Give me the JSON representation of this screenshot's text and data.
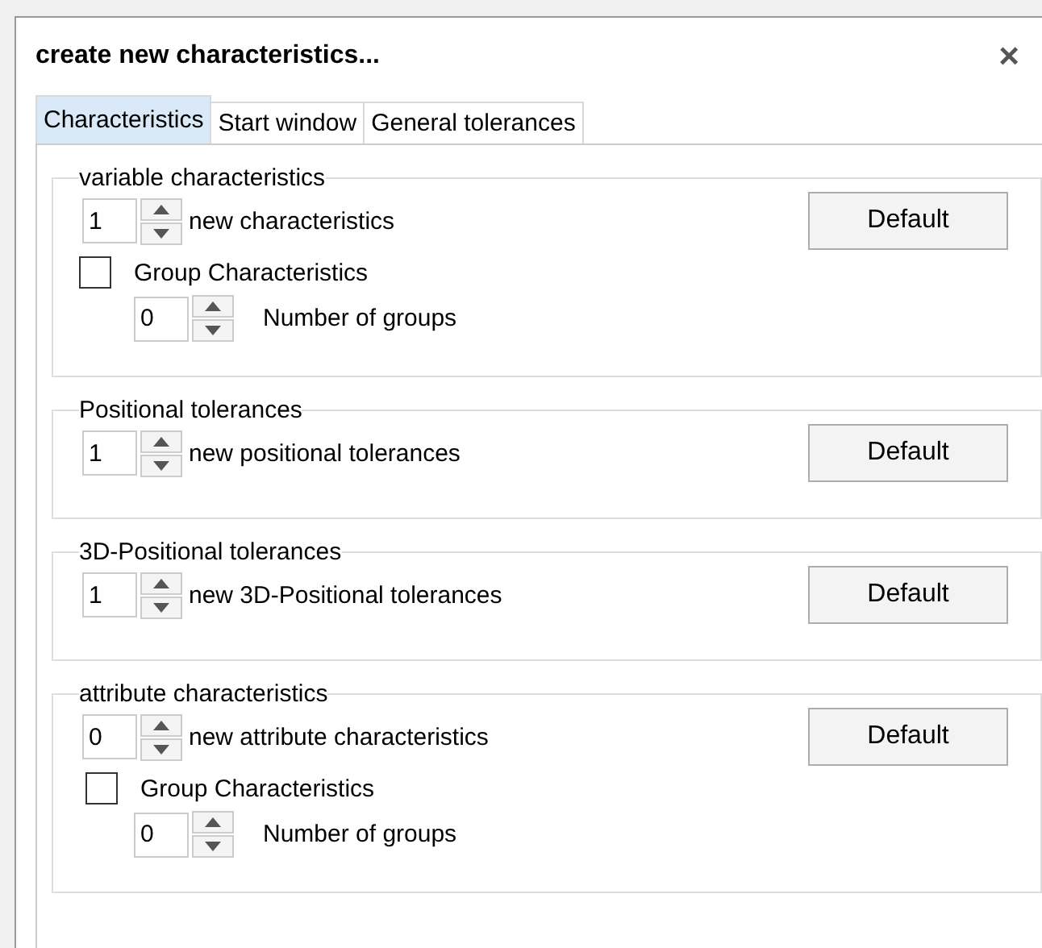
{
  "window": {
    "title": "create new characteristics...",
    "close": "×"
  },
  "tabs": [
    {
      "label": "Characteristics",
      "selected": true
    },
    {
      "label": "Start window",
      "selected": false
    },
    {
      "label": "General tolerances",
      "selected": false
    }
  ],
  "groups": [
    {
      "title": "variable characteristics",
      "count": {
        "value": "1",
        "label": "new characteristics"
      },
      "button": "Default",
      "option": {
        "label": "Group Characteristics",
        "checked": false
      },
      "groups_count": {
        "value": "0",
        "label": "Number of groups"
      }
    },
    {
      "title": "Positional tolerances",
      "count": {
        "value": "1",
        "label": "new positional tolerances"
      },
      "button": "Default"
    },
    {
      "title": "3D-Positional tolerances",
      "count": {
        "value": "1",
        "label": "new 3D-Positional tolerances"
      },
      "button": "Default"
    },
    {
      "title": "attribute characteristics",
      "count": {
        "value": "0",
        "label": "new attribute characteristics"
      },
      "button": "Default",
      "option": {
        "label": "Group Characteristics",
        "checked": false
      },
      "groups_count": {
        "value": "0",
        "label": "Number of groups"
      }
    }
  ]
}
